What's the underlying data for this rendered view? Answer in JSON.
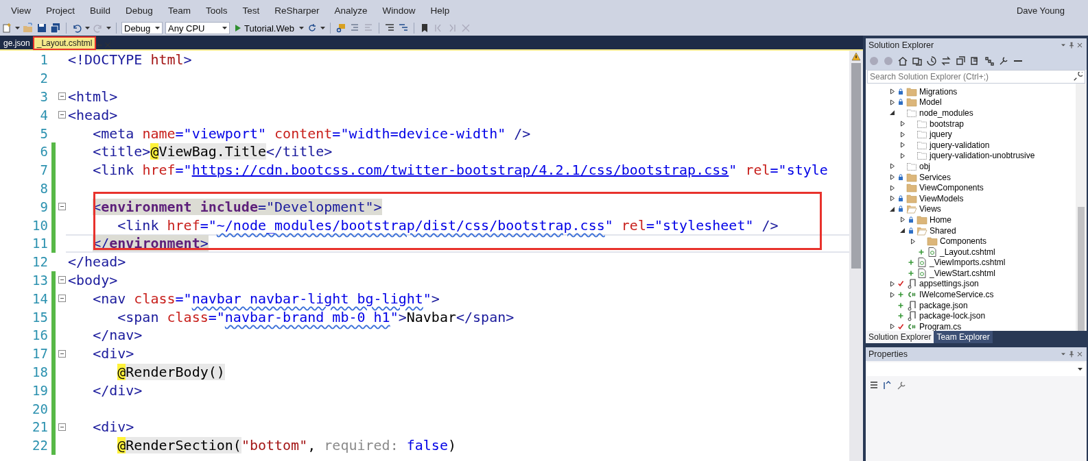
{
  "menu": {
    "items": [
      "View",
      "Project",
      "Build",
      "Debug",
      "Team",
      "Tools",
      "Test",
      "ReSharper",
      "Analyze",
      "Window",
      "Help"
    ],
    "user": "Dave Young"
  },
  "toolbar": {
    "configuration": "Debug",
    "platform": "Any CPU",
    "start": "Tutorial.Web"
  },
  "tabs": [
    {
      "label": "ge.json",
      "selected": false,
      "annotated": false
    },
    {
      "label": "_Layout.cshtml",
      "selected": true,
      "annotated": true
    }
  ],
  "editor": {
    "lines": [
      {
        "number": "1",
        "changed": false,
        "foldable": false,
        "current": false,
        "tokens": [
          {
            "kind": "tag",
            "text": "<!DOCTYPE"
          },
          {
            "kind": "str",
            "text": " html"
          },
          {
            "kind": "tag",
            "text": ">"
          }
        ]
      },
      {
        "number": "2",
        "changed": false,
        "foldable": false,
        "current": false
      },
      {
        "number": "3",
        "changed": false,
        "foldable": true,
        "current": false,
        "tokens": [
          {
            "kind": "tag",
            "text": "<html>"
          }
        ]
      },
      {
        "number": "4",
        "changed": false,
        "foldable": true,
        "current": false,
        "tokens": [
          {
            "kind": "tag",
            "text": "<head>"
          }
        ]
      },
      {
        "number": "5",
        "changed": false,
        "foldable": false,
        "current": false,
        "tokens": [
          {
            "kind": "tag",
            "text": "   <meta"
          },
          {
            "kind": "attr",
            "text": " name"
          },
          {
            "kind": "value",
            "text": "=\"viewport\""
          },
          {
            "kind": "attr",
            "text": " content"
          },
          {
            "kind": "value",
            "text": "=\"width=device-width\""
          },
          {
            "kind": "tag",
            "text": " />"
          }
        ]
      },
      {
        "number": "6",
        "changed": true,
        "foldable": false,
        "current": false,
        "tokens": [
          {
            "kind": "tag",
            "text": "   <title>"
          },
          {
            "kind": "razor",
            "text": "@"
          },
          {
            "kind": "razor-expr",
            "text": "ViewBag.Title"
          },
          {
            "kind": "tag",
            "text": "</title>"
          }
        ]
      },
      {
        "number": "7",
        "changed": true,
        "foldable": false,
        "current": false,
        "tokens": [
          {
            "kind": "tag",
            "text": "   <link"
          },
          {
            "kind": "attr",
            "text": " href"
          },
          {
            "kind": "value",
            "text": "=\""
          },
          {
            "kind": "url",
            "text": "https://cdn.bootcss.com/twitter-bootstrap/4.2.1/css/bootstrap.css"
          },
          {
            "kind": "value",
            "text": "\""
          },
          {
            "kind": "attr",
            "text": " rel"
          },
          {
            "kind": "value",
            "text": "=\"style"
          }
        ]
      },
      {
        "number": "8",
        "changed": true,
        "foldable": false,
        "current": false
      },
      {
        "number": "9",
        "changed": true,
        "foldable": true,
        "current": false,
        "tokens": [
          {
            "kind": "env-punct",
            "text": "   <"
          },
          {
            "kind": "env-tag",
            "text": "environment include"
          },
          {
            "kind": "env-punct",
            "text": "=\"Development\">"
          }
        ]
      },
      {
        "number": "10",
        "changed": true,
        "foldable": false,
        "current": false,
        "tokens": [
          {
            "kind": "tag",
            "text": "      <link"
          },
          {
            "kind": "attr",
            "text": " href"
          },
          {
            "kind": "value",
            "text": "=\""
          },
          {
            "kind": "squiggle",
            "text": "~/node_modules/bootstrap/dist/css/bootstrap.css"
          },
          {
            "kind": "value",
            "text": "\""
          },
          {
            "kind": "attr",
            "text": " rel"
          },
          {
            "kind": "value",
            "text": "=\"stylesheet\""
          },
          {
            "kind": "tag",
            "text": " />"
          }
        ]
      },
      {
        "number": "11",
        "changed": true,
        "foldable": false,
        "current": true,
        "tokens": [
          {
            "kind": "env-punct",
            "text": "   </"
          },
          {
            "kind": "env-tag",
            "text": "environment"
          },
          {
            "kind": "env-punct",
            "text": ">"
          }
        ]
      },
      {
        "number": "12",
        "changed": false,
        "foldable": false,
        "current": false,
        "tokens": [
          {
            "kind": "tag",
            "text": "</head>"
          }
        ]
      },
      {
        "number": "13",
        "changed": true,
        "foldable": true,
        "current": false,
        "tokens": [
          {
            "kind": "tag",
            "text": "<body>"
          }
        ]
      },
      {
        "number": "14",
        "changed": true,
        "foldable": true,
        "current": false,
        "tokens": [
          {
            "kind": "tag",
            "text": "   <nav"
          },
          {
            "kind": "attr",
            "text": " class"
          },
          {
            "kind": "value",
            "text": "=\""
          },
          {
            "kind": "squiggle",
            "text": "navbar navbar-light bg-light"
          },
          {
            "kind": "value",
            "text": "\""
          },
          {
            "kind": "tag",
            "text": ">"
          }
        ]
      },
      {
        "number": "15",
        "changed": true,
        "foldable": false,
        "current": false,
        "tokens": [
          {
            "kind": "tag",
            "text": "      <span"
          },
          {
            "kind": "attr",
            "text": " class"
          },
          {
            "kind": "value",
            "text": "=\""
          },
          {
            "kind": "squiggle",
            "text": "navbar-brand mb-0 h1"
          },
          {
            "kind": "value",
            "text": "\""
          },
          {
            "kind": "tag",
            "text": ">"
          },
          {
            "kind": "plain",
            "text": "Navbar"
          },
          {
            "kind": "tag",
            "text": "</span>"
          }
        ]
      },
      {
        "number": "16",
        "changed": true,
        "foldable": false,
        "current": false,
        "tokens": [
          {
            "kind": "tag",
            "text": "   </nav>"
          }
        ]
      },
      {
        "number": "17",
        "changed": true,
        "foldable": true,
        "current": false,
        "tokens": [
          {
            "kind": "tag",
            "text": "   <div>"
          }
        ]
      },
      {
        "number": "18",
        "changed": true,
        "foldable": false,
        "current": false,
        "tokens": [
          {
            "kind": "razor",
            "text": "      @"
          },
          {
            "kind": "razor-expr",
            "text": "RenderBody()"
          }
        ]
      },
      {
        "number": "19",
        "changed": true,
        "foldable": false,
        "current": false,
        "tokens": [
          {
            "kind": "tag",
            "text": "   </div>"
          }
        ]
      },
      {
        "number": "20",
        "changed": true,
        "foldable": false,
        "current": false
      },
      {
        "number": "21",
        "changed": true,
        "foldable": true,
        "current": false,
        "tokens": [
          {
            "kind": "tag",
            "text": "   <div>"
          }
        ]
      },
      {
        "number": "22",
        "changed": true,
        "foldable": false,
        "current": false,
        "tokens": [
          {
            "kind": "razor",
            "text": "      @"
          },
          {
            "kind": "razor-expr",
            "text": "RenderSection("
          },
          {
            "kind": "str",
            "text": "\"bottom\""
          },
          {
            "kind": "plain",
            "text": ", "
          },
          {
            "kind": "hint",
            "text": "required:"
          },
          {
            "kind": "keyword",
            "text": " false"
          },
          {
            "kind": "plain",
            "text": ")"
          }
        ]
      }
    ]
  },
  "solution_explorer": {
    "title": "Solution Explorer",
    "search": {
      "placeholder": "Search Solution Explorer (Ctrl+;)"
    },
    "tree": [
      {
        "label": "Migrations",
        "kind": "locked-folder",
        "expanded": false
      },
      {
        "label": "Model",
        "kind": "locked-folder",
        "expanded": false
      },
      {
        "label": "node_modules",
        "kind": "dashed-folder",
        "expanded": true,
        "children": [
          {
            "label": "bootstrap",
            "kind": "dashed-folder",
            "expanded": false
          },
          {
            "label": "jquery",
            "kind": "dashed-folder",
            "expanded": false
          },
          {
            "label": "jquery-validation",
            "kind": "dashed-folder",
            "expanded": false
          },
          {
            "label": "jquery-validation-unobtrusive",
            "kind": "dashed-folder",
            "expanded": false
          }
        ]
      },
      {
        "label": "obj",
        "kind": "dashed-folder",
        "expanded": false
      },
      {
        "label": "Services",
        "kind": "locked-folder",
        "expanded": false
      },
      {
        "label": "ViewComponents",
        "kind": "folder",
        "expanded": false
      },
      {
        "label": "ViewModels",
        "kind": "locked-folder",
        "expanded": false
      },
      {
        "label": "Views",
        "kind": "locked-open-folder",
        "expanded": true,
        "children": [
          {
            "label": "Home",
            "kind": "locked-folder",
            "expanded": false
          },
          {
            "label": "Shared",
            "kind": "locked-open-folder",
            "expanded": true,
            "children": [
              {
                "label": "Components",
                "kind": "folder",
                "expanded": false
              },
              {
                "label": "_Layout.cshtml",
                "kind": "added-view"
              }
            ]
          },
          {
            "label": "_ViewImports.cshtml",
            "kind": "added-view"
          },
          {
            "label": "_ViewStart.cshtml",
            "kind": "added-view"
          }
        ]
      },
      {
        "label": "appsettings.json",
        "kind": "modified-json",
        "expanded": false
      },
      {
        "label": "IWelcomeService.cs",
        "kind": "added-code",
        "expanded": false
      },
      {
        "label": "package.json",
        "kind": "added-json"
      },
      {
        "label": "package-lock.json",
        "kind": "added-json"
      },
      {
        "label": "Program.cs",
        "kind": "modified-code",
        "expanded": false
      }
    ],
    "tabs": [
      {
        "label": "Solution Explorer",
        "selected": true
      },
      {
        "label": "Team Explorer",
        "selected": false
      }
    ]
  },
  "properties": {
    "title": "Properties"
  }
}
